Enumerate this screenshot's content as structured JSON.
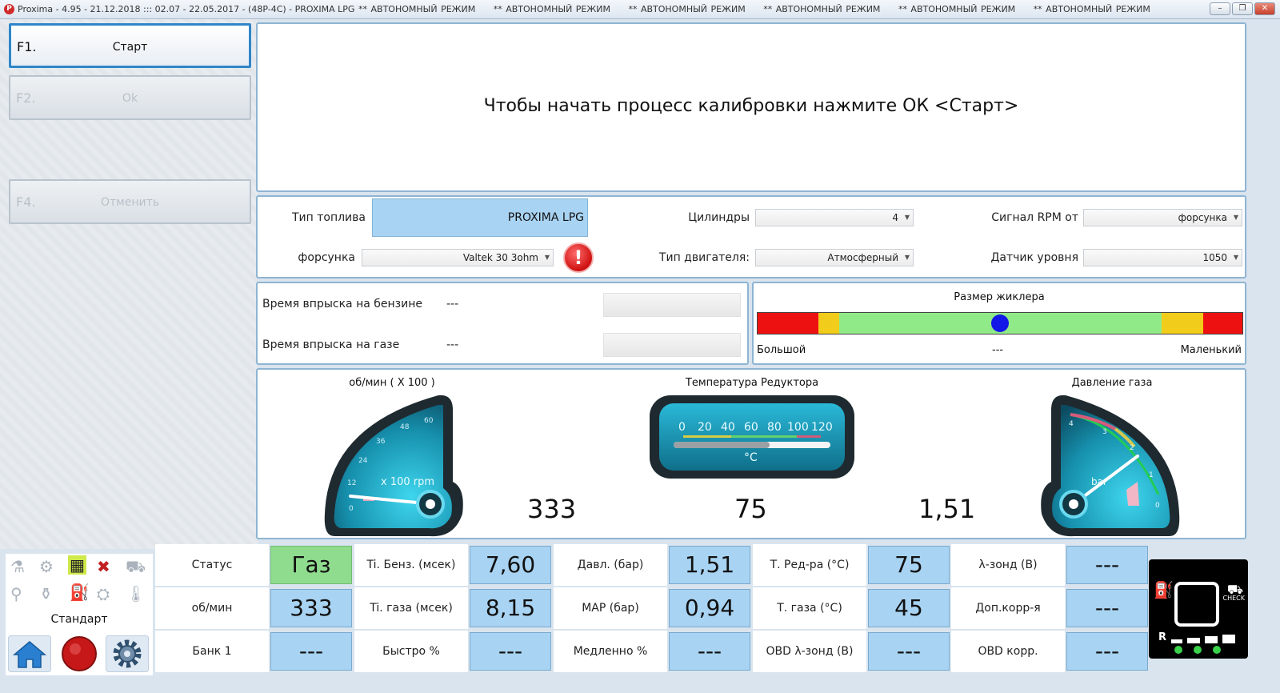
{
  "window": {
    "title": "Proxima - 4.95 - 21.12.2018 ::: 02.07 - 22.05.2017 - (48P-4C) - PROXIMA LPG",
    "modes": [
      "** АВТОНОМНЫЙ РЕЖИМ",
      "** АВТОНОМНЫЙ РЕЖИМ",
      "** АВТОНОМНЫЙ РЕЖИМ",
      "** АВТОНОМНЫЙ РЕЖИМ",
      "** АВТОНОМНЫЙ РЕЖИМ",
      "** АВТОНОМНЫЙ РЕЖИМ"
    ]
  },
  "left": {
    "f1": {
      "key": "F1.",
      "label": "Старт"
    },
    "f2": {
      "key": "F2.",
      "label": "Ok"
    },
    "f4": {
      "key": "F4.",
      "label": "Отменить"
    }
  },
  "message": "Чтобы начать процесс калибровки нажмите ОК <Старт>",
  "settings": {
    "fuel_type_label": "Тип топлива",
    "fuel_type_value": "PROXIMA LPG",
    "injector_label": "форсунка",
    "injector_value": "Valtek 30 3ohm",
    "cylinders_label": "Цилиндры",
    "cylinders_value": "4",
    "engine_type_label": "Тип двигателя:",
    "engine_type_value": "Атмосферный",
    "rpm_signal_label": "Сигнал RPM от",
    "rpm_signal_value": "форсунка",
    "level_sensor_label": "Датчик уровня",
    "level_sensor_value": "1050"
  },
  "injection": {
    "petrol_label": "Время впрыска на бензине",
    "petrol_value": "---",
    "gas_label": "Время впрыска на газе",
    "gas_value": "---"
  },
  "jet": {
    "title": "Размер жиклера",
    "left_label": "Большой",
    "center_value": "---",
    "right_label": "Маленький",
    "colors": {
      "red": "#ee1111",
      "yellow": "#f2cc1a",
      "green": "#90ea88",
      "dot": "#1318e6"
    }
  },
  "gauges": {
    "rpm": {
      "title": "об/мин ( X 100 )",
      "value": "333",
      "unit": "x 100 rpm",
      "ticks": [
        "0",
        "12",
        "24",
        "36",
        "48",
        "60"
      ]
    },
    "temp": {
      "title": "Температура Редуктора",
      "value": "75",
      "unit": "°C",
      "ticks": [
        "0",
        "20",
        "40",
        "60",
        "80",
        "100",
        "120"
      ]
    },
    "pressure": {
      "title": "Давление газа",
      "value": "1,51",
      "unit": "bar",
      "ticks": [
        "4",
        "3",
        "2",
        "1",
        "0"
      ]
    }
  },
  "bottom": {
    "mode_label": "Стандарт",
    "rows": [
      [
        {
          "label": "Статус",
          "value": "Газ",
          "green": true
        },
        {
          "label": "Ti. Бенз. (мсек)",
          "value": "7,60"
        },
        {
          "label": "Давл. (бар)",
          "value": "1,51"
        },
        {
          "label": "Т. Ред-ра (°C)",
          "value": "75"
        },
        {
          "label": "λ-зонд (В)",
          "value": "---"
        }
      ],
      [
        {
          "label": "об/мин",
          "value": "333"
        },
        {
          "label": "Ti. газа (мсек)",
          "value": "8,15"
        },
        {
          "label": "МАР (бар)",
          "value": "0,94"
        },
        {
          "label": "Т. газа (°C)",
          "value": "45"
        },
        {
          "label": "Доп.корр-я",
          "value": "---"
        }
      ],
      [
        {
          "label": "Банк 1",
          "value": "---"
        },
        {
          "label": "Быстро %",
          "value": "---"
        },
        {
          "label": "Медленно %",
          "value": "---"
        },
        {
          "label": "OBD λ-зонд (В)",
          "value": "---"
        },
        {
          "label": "OBD корр.",
          "value": "---"
        }
      ]
    ]
  },
  "dashboard": {
    "check": "CHECK",
    "reverse": "R"
  }
}
